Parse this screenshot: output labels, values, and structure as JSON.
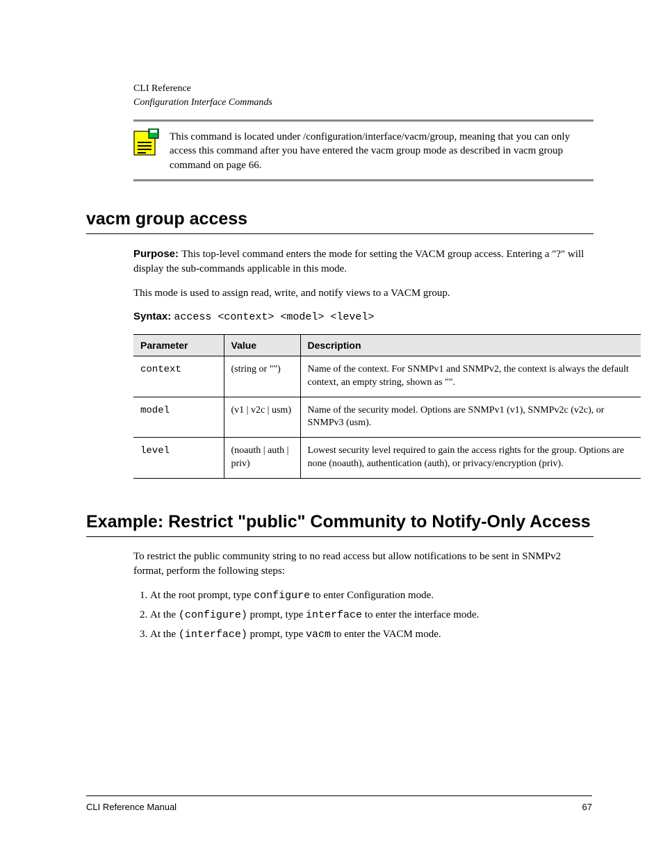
{
  "header": {
    "label": "CLI Reference",
    "title": "Configuration Interface Commands"
  },
  "note": {
    "text": "This command is located under /configuration/interface/vacm/group, meaning that you can only access this command after you have entered the vacm group mode as described in vacm group command on page 66."
  },
  "section1": {
    "heading": "vacm group access",
    "purpose_label": "Purpose: ",
    "purpose_body1": "This top-level command enters the mode for setting the VACM group access. Entering a \"?\" will display the sub-commands applicable in this mode.",
    "purpose_body2": "This mode is used to assign read, write, and notify views to a VACM group.",
    "syntax_label": "Syntax: ",
    "syntax_code": "access <context> <model> <level>",
    "table": {
      "headers": [
        "Parameter",
        "Value",
        "Description"
      ],
      "rows": [
        {
          "param": "context",
          "value": "(string or \"\")",
          "desc": "Name of the context. For SNMPv1 and SNMPv2, the context is always the default context, an empty string, shown as \"\"."
        },
        {
          "param": "model",
          "value": "(v1 | v2c | usm)",
          "desc": "Name of the security model. Options are SNMPv1 (v1), SNMPv2c (v2c), or SNMPv3 (usm)."
        },
        {
          "param": "level",
          "value": "(noauth | auth | priv)",
          "desc": "Lowest security level required to gain the access rights for the group. Options are none (noauth), authentication (auth), or privacy/encryption (priv)."
        }
      ]
    }
  },
  "section2": {
    "heading": "Example: Restrict \"public\" Community to Notify-Only Access",
    "intro": "To restrict the public community string to no read access but allow notifications to be sent in SNMPv2 format, perform the following steps:",
    "steps": [
      "At the root prompt, type configure to enter Configuration mode.",
      "At the (configure) prompt, type interface to enter the interface mode.",
      "At the (interface) prompt, type vacm to enter the VACM mode."
    ]
  },
  "footer": {
    "left": "CLI Reference Manual",
    "right": "67"
  }
}
